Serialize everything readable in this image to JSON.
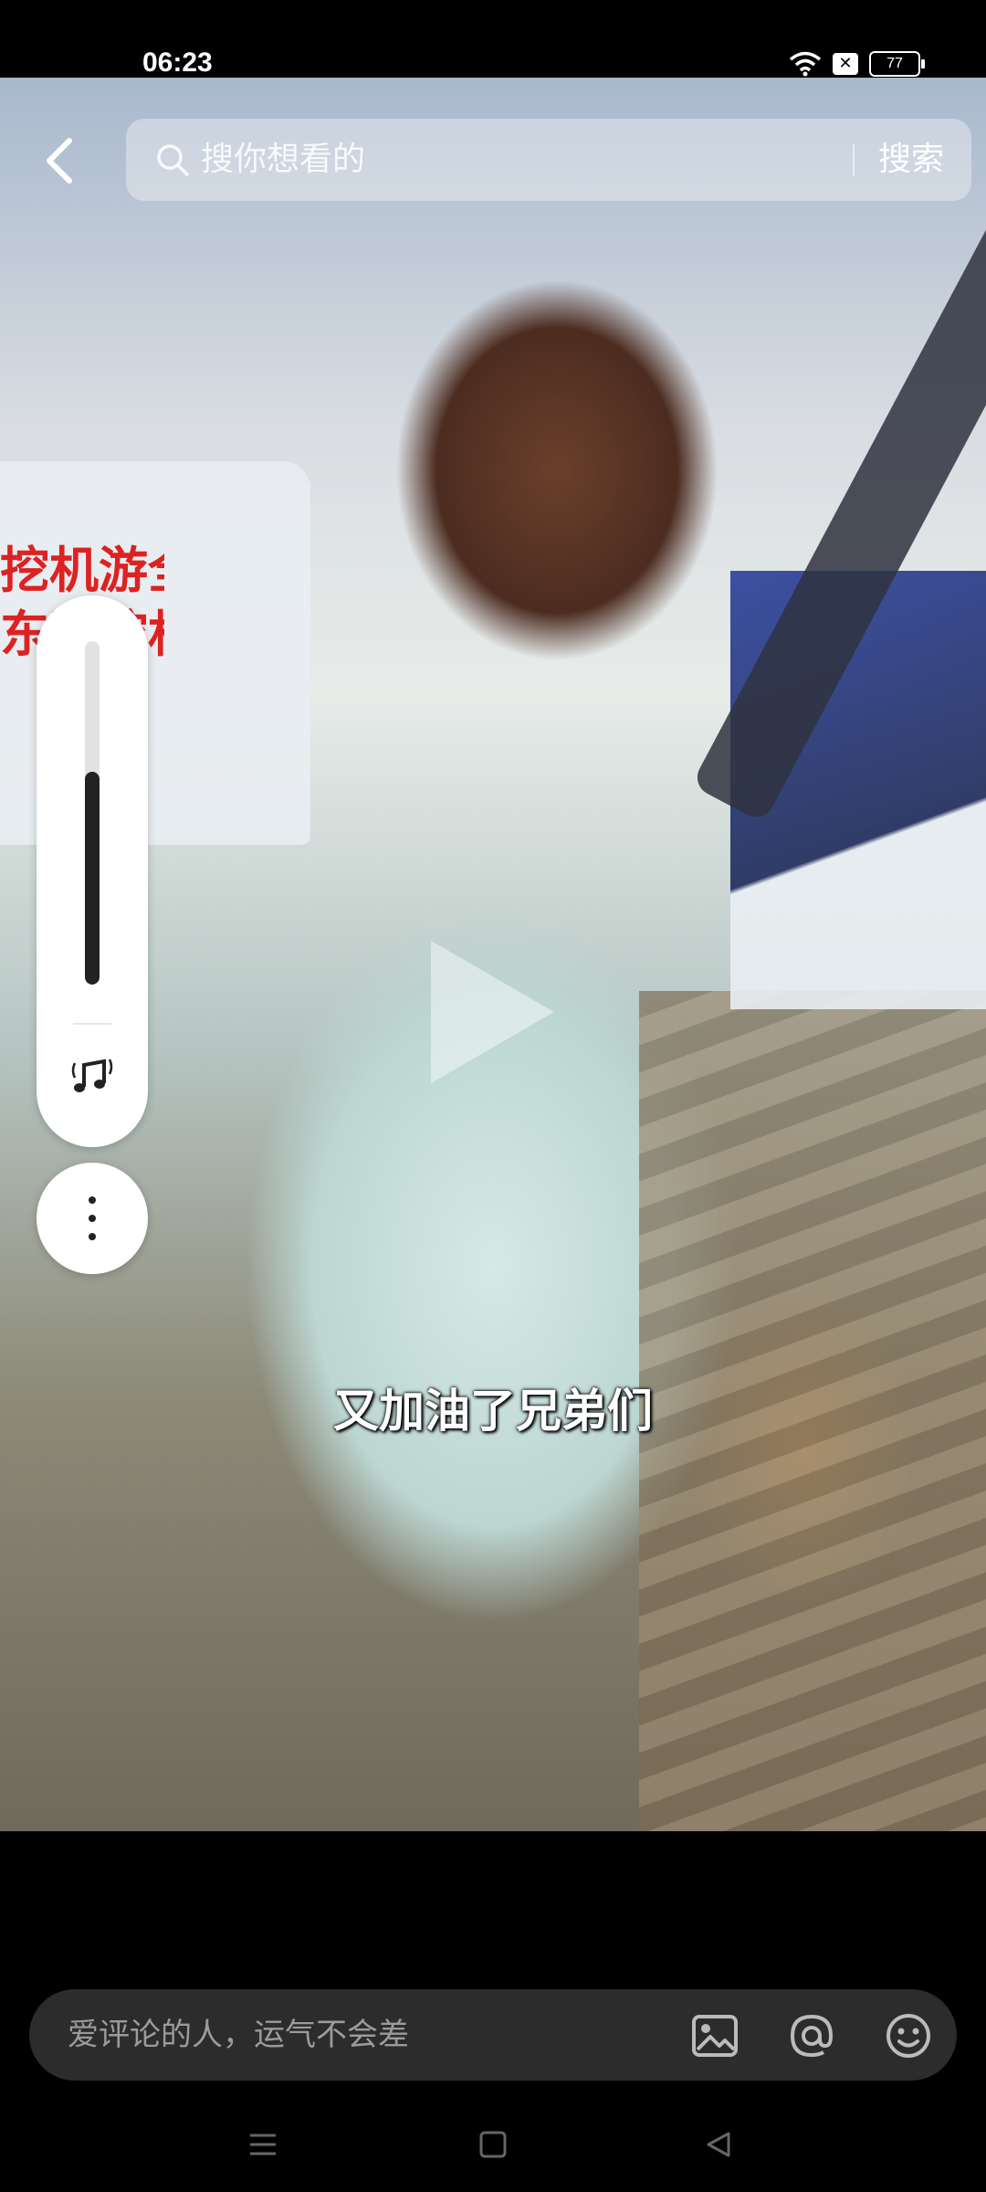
{
  "status_bar": {
    "time": "06:23",
    "battery": "77",
    "icons": [
      "wifi-icon",
      "x-box-icon",
      "battery-icon"
    ]
  },
  "search": {
    "placeholder": "搜你想看的",
    "button_label": "搜索"
  },
  "video": {
    "caption": "又加油了兄弟们",
    "banner_text": "挖机游全国",
    "banner_text_2": "东哥挖机",
    "volume_level": 0.62
  },
  "comment": {
    "placeholder": "爱评论的人，运气不会差",
    "icons": [
      "image-icon",
      "at-icon",
      "emoji-icon"
    ]
  },
  "nav": {
    "icons": [
      "menu-icon",
      "home-icon",
      "back-icon"
    ]
  },
  "colors": {
    "background": "#000000",
    "panel": "#ffffff",
    "comment_bar": "#2c2c2c",
    "placeholder_text": "#9b9b9b"
  }
}
